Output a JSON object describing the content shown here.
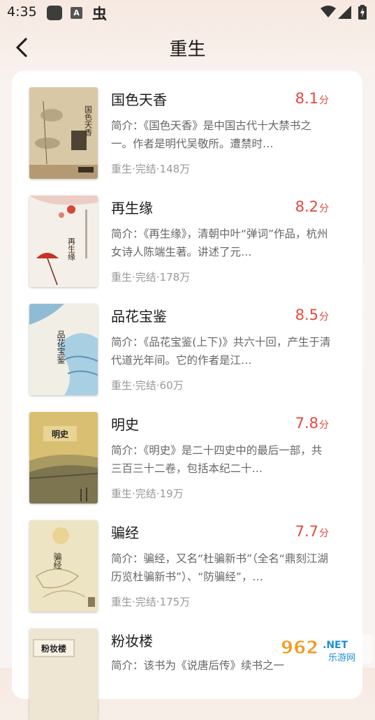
{
  "status_bar": {
    "time": "4:35",
    "notif_a": "A",
    "notif_glyph": "虫"
  },
  "header": {
    "title": "重生"
  },
  "colors": {
    "accent": "#e6483d",
    "meta": "#999999",
    "intro": "#666666"
  },
  "books": [
    {
      "title": "国色天香",
      "score": "8.1",
      "score_unit": "分",
      "intro": "简介：《国色天香》是中国古代十大禁书之一。作者是明代吴敬所。遭禁时…",
      "meta": "重生·完结·148万",
      "cover_title": "国色天香"
    },
    {
      "title": "再生缘",
      "score": "8.2",
      "score_unit": "分",
      "intro": "简介：《再生缘》，清朝中叶“弹词”作品，杭州女诗人陈端生著。讲述了元…",
      "meta": "重生·完结·178万",
      "cover_title": "再生缘"
    },
    {
      "title": "品花宝鉴",
      "score": "8.5",
      "score_unit": "分",
      "intro": "简介：《品花宝鉴(上下)》共六十回，产生于清代道光年间。它的作者是江…",
      "meta": "重生·完结·60万",
      "cover_title": "品花宝鉴"
    },
    {
      "title": "明史",
      "score": "7.8",
      "score_unit": "分",
      "intro": "简介：《明史》是二十四史中的最后一部，共三百三十二卷，包括本纪二十…",
      "meta": "重生·完结·19万",
      "cover_title": "明史"
    },
    {
      "title": "骗经",
      "score": "7.7",
      "score_unit": "分",
      "intro": "简介：骗经，又名“杜骗新书”（全名“鼎刻江湖历览杜骗新书”）、“防骗经”，…",
      "meta": "重生·完结·175万",
      "cover_title": "骗经"
    },
    {
      "title": "粉妆楼",
      "score": "",
      "score_unit": "",
      "intro": "简介：该书为《说唐后传》续书之一",
      "meta": "",
      "cover_title": "粉妆楼"
    }
  ],
  "watermark": {
    "brand": "962",
    "tld": ".NET",
    "site": "乐游网"
  }
}
